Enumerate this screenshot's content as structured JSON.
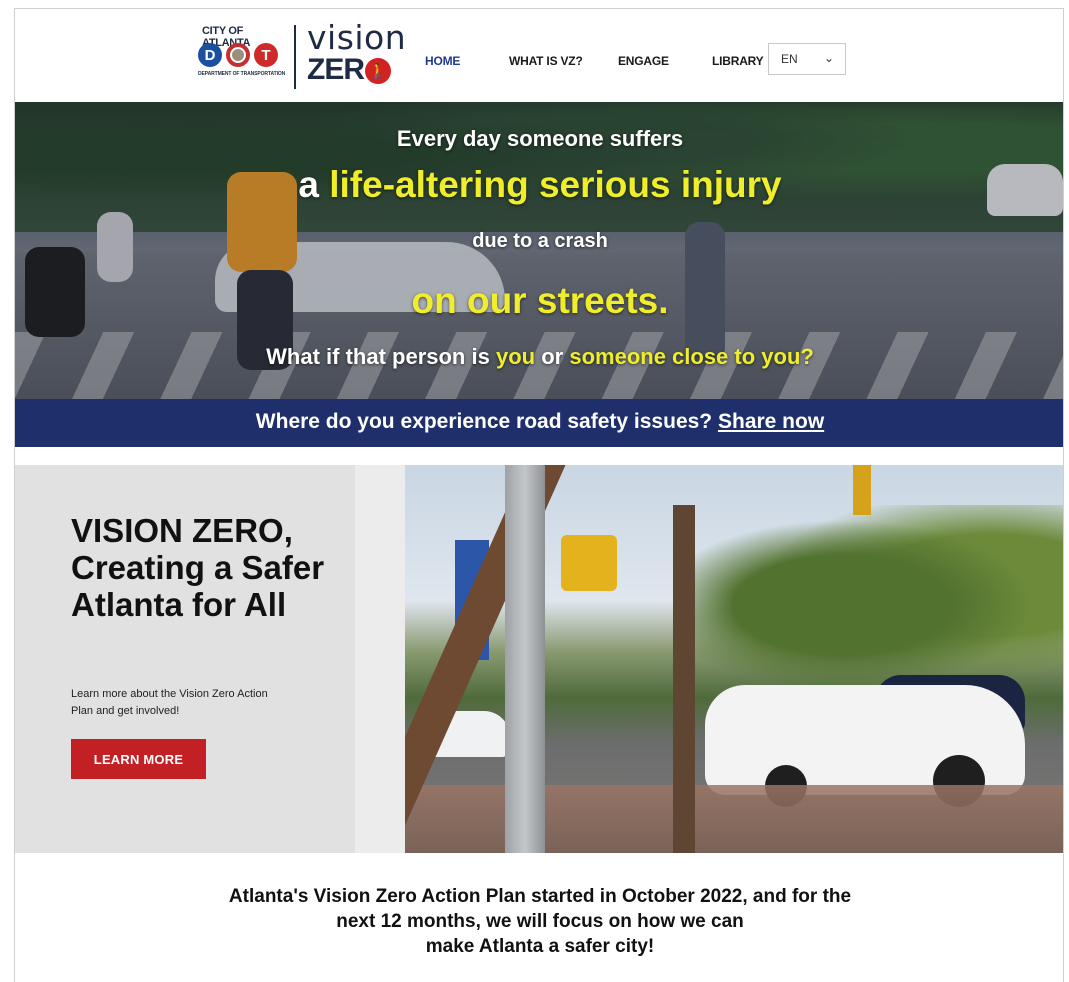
{
  "header": {
    "city_text": "CITY OF ATLANTA",
    "dept_letters": [
      "D",
      "T"
    ],
    "dept_text": "DEPARTMENT OF TRANSPORTATION",
    "brand_top": "vision",
    "brand_bottom": "ZER",
    "nav": [
      {
        "label": "HOME",
        "active": true
      },
      {
        "label": "WHAT IS VZ?",
        "active": false
      },
      {
        "label": "ENGAGE",
        "active": false
      },
      {
        "label": "LIBRARY",
        "active": false
      }
    ],
    "language": {
      "selected": "EN",
      "chevron_icon": "chevron-down-icon"
    }
  },
  "hero": {
    "line1": "Every day someone suffers",
    "line2_prefix": "a",
    "line2_highlight": "life-altering serious injury",
    "line3": "due to a crash",
    "line4": "on our streets.",
    "line5_prefix": "What if that person is",
    "line5_hl1": "you",
    "line5_mid": "or",
    "line5_hl2": "someone close to you?",
    "highlight_color": "#f0ee2b"
  },
  "banner": {
    "text": "Where do you experience road safety issues?",
    "link": "Share now",
    "color": "#1f2f6b"
  },
  "vision": {
    "title_lines": [
      "VISION ZERO,",
      "Creating a Safer",
      "Atlanta for All"
    ],
    "description": "Learn more about the Vision Zero Action Plan and get involved!",
    "button": "LEARN MORE",
    "button_color": "#c32026"
  },
  "intro": {
    "lines": [
      "Atlanta's Vision Zero Action Plan started in October 2022, and for the",
      "next 12 months, we will focus on how we can",
      "make Atlanta a safer city!"
    ]
  }
}
